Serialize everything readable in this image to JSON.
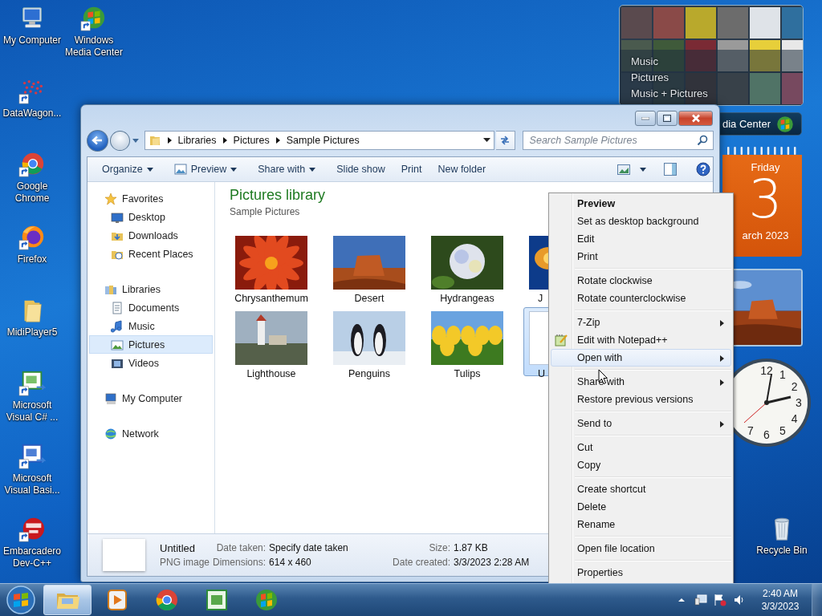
{
  "desktop_icons": [
    {
      "label": "My Computer",
      "kind": "computer",
      "shortcut": false
    },
    {
      "label": "DataWagon...",
      "kind": "dots",
      "shortcut": true
    },
    {
      "label": "Google Chrome",
      "kind": "chrome",
      "shortcut": true
    },
    {
      "label": "Firefox",
      "kind": "firefox",
      "shortcut": true
    },
    {
      "label": "MidiPlayer5",
      "kind": "folder",
      "shortcut": false
    },
    {
      "label": "Microsoft Visual C# ...",
      "kind": "csharp",
      "shortcut": true
    },
    {
      "label": "Microsoft Visual Basi...",
      "kind": "vb",
      "shortcut": true
    },
    {
      "label": "Embarcadero Dev-C++",
      "kind": "devcpp",
      "shortcut": true
    }
  ],
  "desktop_icons_column_2": [
    {
      "label": "Windows Media Center",
      "kind": "media-center",
      "shortcut": true
    }
  ],
  "recycle_bin": {
    "label": "Recycle Bin"
  },
  "media_center_gadget": {
    "items": [
      "Music",
      "Pictures",
      "Music + Pictures"
    ],
    "title": "dia Center"
  },
  "calendar_gadget": {
    "weekday": "Friday",
    "day": "3",
    "month": "arch 2023"
  },
  "clock_gadget": {
    "numerals": [
      "12",
      "1",
      "2",
      "3",
      "4",
      "5",
      "6",
      "7"
    ]
  },
  "address_bar": {
    "crumbs": [
      "Libraries",
      "Pictures",
      "Sample Pictures"
    ]
  },
  "search": {
    "placeholder": "Search Sample Pictures"
  },
  "toolbar": [
    {
      "label": "Organize",
      "kind": "plain",
      "dropdown": true
    },
    {
      "label": "Preview",
      "kind": "preview",
      "dropdown": true
    },
    {
      "label": "Share with",
      "kind": "plain",
      "dropdown": true
    },
    {
      "label": "Slide show",
      "kind": "plain",
      "dropdown": false
    },
    {
      "label": "Print",
      "kind": "plain",
      "dropdown": false
    },
    {
      "label": "New folder",
      "kind": "plain",
      "dropdown": false
    }
  ],
  "navigation": [
    {
      "label": "Favorites",
      "kind": "star",
      "selected": false,
      "children": [
        {
          "label": "Desktop",
          "kind": "desktop",
          "selected": false
        },
        {
          "label": "Downloads",
          "kind": "downloads",
          "selected": false
        },
        {
          "label": "Recent Places",
          "kind": "recent",
          "selected": false
        }
      ]
    },
    {
      "label": "Libraries",
      "kind": "library",
      "selected": false,
      "children": [
        {
          "label": "Documents",
          "kind": "documents",
          "selected": false
        },
        {
          "label": "Music",
          "kind": "music",
          "selected": false
        },
        {
          "label": "Pictures",
          "kind": "pictures",
          "selected": true
        },
        {
          "label": "Videos",
          "kind": "videos",
          "selected": false
        }
      ]
    },
    {
      "label": "My Computer",
      "kind": "computer",
      "selected": false
    },
    {
      "label": "Network",
      "kind": "network",
      "selected": false
    }
  ],
  "library": {
    "title": "Pictures library",
    "subtitle": "Sample Pictures"
  },
  "files": [
    {
      "name": "Chrysanthemum",
      "kind": "flower",
      "selected": false
    },
    {
      "name": "Desert",
      "kind": "desert",
      "selected": false
    },
    {
      "name": "Hydrangeas",
      "kind": "hydrangea",
      "selected": false
    },
    {
      "name": "J",
      "kind": "jellyfish",
      "selected": false
    },
    {
      "name": "Lighthouse",
      "kind": "lighthouse",
      "selected": false
    },
    {
      "name": "Penguins",
      "kind": "penguins",
      "selected": false
    },
    {
      "name": "Tulips",
      "kind": "tulips",
      "selected": false
    },
    {
      "name": "U",
      "kind": "blank",
      "selected": true
    }
  ],
  "details": {
    "name": "Untitled",
    "type": "PNG image",
    "fields": [
      {
        "label": "Date taken:",
        "value": "Specify date taken"
      },
      {
        "label": "Size:",
        "value": "1.87 KB"
      },
      {
        "label": "Dimensions:",
        "value": "614 x 460"
      },
      {
        "label": "Date created:",
        "value": "3/3/2023 2:28 AM"
      }
    ]
  },
  "context_menu": {
    "groups": [
      [
        {
          "label": "Preview",
          "default": true,
          "submenu": false,
          "selected": false,
          "icon": false
        },
        {
          "label": "Set as desktop background",
          "default": false,
          "submenu": false,
          "selected": false,
          "icon": false
        },
        {
          "label": "Edit",
          "default": false,
          "submenu": false,
          "selected": false,
          "icon": false
        },
        {
          "label": "Print",
          "default": false,
          "submenu": false,
          "selected": false,
          "icon": false
        }
      ],
      [
        {
          "label": "Rotate clockwise",
          "default": false,
          "submenu": false,
          "selected": false,
          "icon": false
        },
        {
          "label": "Rotate counterclockwise",
          "default": false,
          "submenu": false,
          "selected": false,
          "icon": false
        }
      ],
      [
        {
          "label": "7-Zip",
          "default": false,
          "submenu": true,
          "selected": false,
          "icon": false
        },
        {
          "label": "Edit with Notepad++",
          "default": false,
          "submenu": false,
          "selected": false,
          "icon": true
        },
        {
          "label": "Open with",
          "default": false,
          "submenu": true,
          "selected": true,
          "icon": false
        }
      ],
      [
        {
          "label": "Share with",
          "default": false,
          "submenu": true,
          "selected": false,
          "icon": false
        },
        {
          "label": "Restore previous versions",
          "default": false,
          "submenu": false,
          "selected": false,
          "icon": false
        }
      ],
      [
        {
          "label": "Send to",
          "default": false,
          "submenu": true,
          "selected": false,
          "icon": false
        }
      ],
      [
        {
          "label": "Cut",
          "default": false,
          "submenu": false,
          "selected": false,
          "icon": false
        },
        {
          "label": "Copy",
          "default": false,
          "submenu": false,
          "selected": false,
          "icon": false
        }
      ],
      [
        {
          "label": "Create shortcut",
          "default": false,
          "submenu": false,
          "selected": false,
          "icon": false
        },
        {
          "label": "Delete",
          "default": false,
          "submenu": false,
          "selected": false,
          "icon": false
        },
        {
          "label": "Rename",
          "default": false,
          "submenu": false,
          "selected": false,
          "icon": false
        }
      ],
      [
        {
          "label": "Open file location",
          "default": false,
          "submenu": false,
          "selected": false,
          "icon": false
        }
      ],
      [
        {
          "label": "Properties",
          "default": false,
          "submenu": false,
          "selected": false,
          "icon": false
        }
      ]
    ]
  },
  "taskbar": {
    "buttons": [
      {
        "kind": "explorer",
        "selected": true
      },
      {
        "kind": "media-player",
        "selected": false
      },
      {
        "kind": "chrome",
        "selected": false
      },
      {
        "kind": "csharp",
        "selected": false
      },
      {
        "kind": "media-center",
        "selected": false
      }
    ]
  },
  "tray": {
    "time": "2:40 AM",
    "date": "3/3/2023"
  }
}
